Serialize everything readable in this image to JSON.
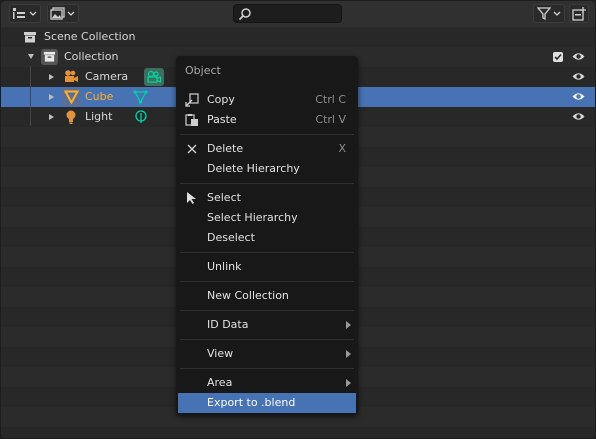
{
  "header": {
    "display_mode_icon": "outliner-icon",
    "filter_icon": "funnel-icon",
    "new_collection_icon": "new-collection-icon",
    "search": {
      "value": "",
      "placeholder": ""
    }
  },
  "outliner": {
    "rows": [
      {
        "label": "Scene Collection"
      },
      {
        "label": "Collection"
      },
      {
        "label": "Camera"
      },
      {
        "label": "Cube"
      },
      {
        "label": "Light"
      }
    ]
  },
  "context_menu": {
    "title": "Object",
    "items": {
      "copy": {
        "label": "Copy",
        "shortcut": "Ctrl C"
      },
      "paste": {
        "label": "Paste",
        "shortcut": "Ctrl V"
      },
      "delete": {
        "label": "Delete",
        "shortcut": "X"
      },
      "delete_hierarchy": {
        "label": "Delete Hierarchy"
      },
      "select": {
        "label": "Select"
      },
      "select_hierarchy": {
        "label": "Select Hierarchy"
      },
      "deselect": {
        "label": "Deselect"
      },
      "unlink": {
        "label": "Unlink"
      },
      "new_collection": {
        "label": "New Collection"
      },
      "id_data": {
        "label": "ID Data"
      },
      "view": {
        "label": "View"
      },
      "area": {
        "label": "Area"
      },
      "export": {
        "label": "Export to .blend"
      }
    }
  },
  "colors": {
    "selection": "#4772b3",
    "active_object_text": "#ffaf29",
    "object_data_icon": "#00d4a3",
    "camera_icon": "#e0933b"
  }
}
